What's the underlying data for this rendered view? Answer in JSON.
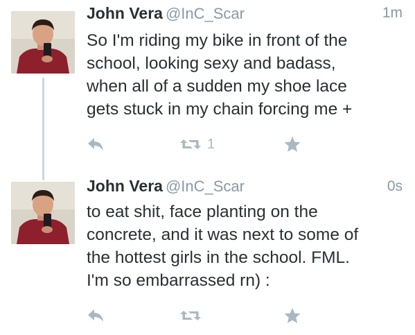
{
  "tweets": [
    {
      "author_name": "John Vera",
      "author_handle": "@InC_Scar",
      "timestamp": "1m",
      "text": "So I'm riding my bike in front of the\nschool, looking sexy and badass,\nwhen all of a sudden my shoe lace\ngets stuck in my chain forcing me +",
      "retweet_count": "1",
      "avatar_icon": "profile-photo"
    },
    {
      "author_name": "John Vera",
      "author_handle": "@InC_Scar",
      "timestamp": "0s",
      "text": "to eat shit, face planting on the\nconcrete, and it was next to some of\nthe hottest girls in the school. FML.\nI'm so embarrassed rn) :",
      "retweet_count": "",
      "avatar_icon": "profile-photo"
    }
  ],
  "icons": {
    "reply": "reply-icon",
    "retweet": "retweet-icon",
    "favorite": "star-icon"
  },
  "colors": {
    "name": "#292f33",
    "meta": "#8899a6",
    "action_icon": "#aab8c2",
    "thread_line": "#ccd6dd"
  }
}
